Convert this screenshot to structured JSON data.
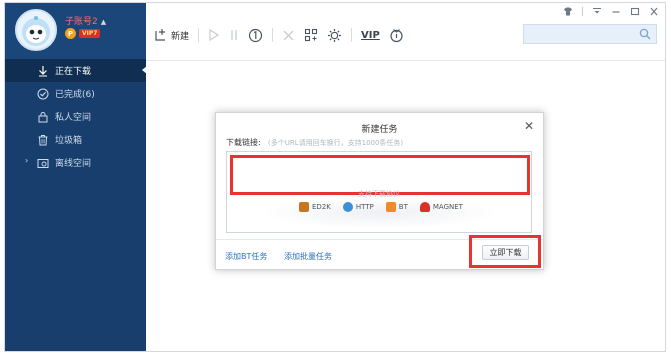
{
  "user": {
    "name": "子账号2",
    "vip_level": "VIP7",
    "vip_dot": "P"
  },
  "sidebar": {
    "items": [
      {
        "label": "正在下载",
        "icon": "download-arrow-icon",
        "active": true
      },
      {
        "label": "已完成(6)",
        "icon": "check-circle-icon"
      },
      {
        "label": "私人空间",
        "icon": "lock-icon"
      },
      {
        "label": "垃圾箱",
        "icon": "trash-icon"
      },
      {
        "label": "离线空间",
        "icon": "cloud-folder-icon"
      }
    ]
  },
  "toolbar": {
    "new_label": "新建",
    "vip_label": "VIP"
  },
  "search": {
    "placeholder": ""
  },
  "dialog": {
    "title": "新建任务",
    "close": "✕",
    "link_label": "下载链接:",
    "link_hint": "(多个URL请用回车换行，支持1000条任务)",
    "protocol_hint": "支持下载协议",
    "protocols": [
      "ED2K",
      "HTTP",
      "BT",
      "MAGNET"
    ],
    "add_bt": "添加BT任务",
    "add_batch": "添加批量任务",
    "confirm": "立即下载"
  },
  "colors": {
    "sidebar_bg": "#173e6c",
    "highlight_red": "#e8342f",
    "link_blue": "#2c6fc2"
  }
}
